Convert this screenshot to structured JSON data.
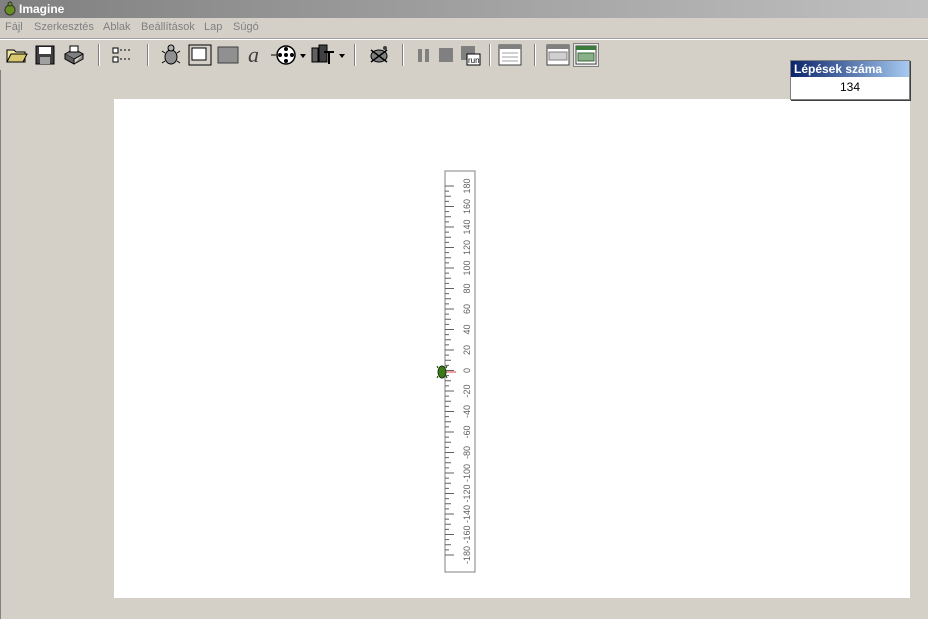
{
  "window": {
    "title": "Imagine"
  },
  "menu": [
    "Fájl",
    "Szerkesztés",
    "Ablak",
    "Beállítások",
    "Lap",
    "Súgó"
  ],
  "toolbar": {
    "icons": [
      "open-folder-icon",
      "save-icon",
      "print-icon",
      "page-layout-icon",
      "turtle-icon",
      "frame-icon",
      "rectangle-icon",
      "text-icon",
      "media-icon",
      "chart-tool-icon",
      "wand-icon",
      "pause-icon",
      "stop-icon",
      "run-icon",
      "window-icon",
      "panel-icon",
      "panel-active-icon"
    ],
    "run_label": "run"
  },
  "counter": {
    "label": "Lépések száma",
    "value": "134"
  },
  "ruler": {
    "ticks": [
      "180",
      "160",
      "140",
      "120",
      "100",
      "80",
      "60",
      "40",
      "20",
      "0",
      "-20",
      "-40",
      "-60",
      "-80",
      "-100",
      "-120",
      "-140",
      "-160",
      "-180"
    ]
  },
  "colors": {
    "titlebar": "#808080",
    "counter_header": "#0a246a",
    "marker": "#e04040",
    "turtle": "#3a7a1a"
  }
}
